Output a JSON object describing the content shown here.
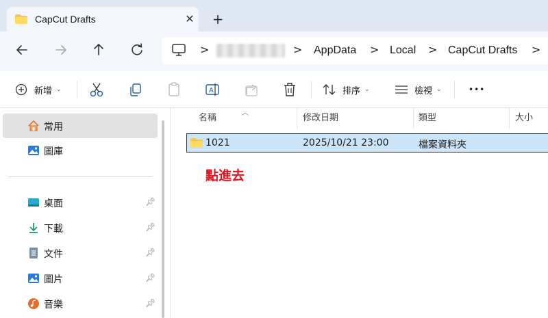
{
  "window": {
    "tab_title": "CapCut Drafts",
    "close_symbol": "✕",
    "new_tab_symbol": "+"
  },
  "nav": {
    "back_icon": "arrow-left-icon",
    "forward_icon": "arrow-right-icon",
    "up_icon": "arrow-up-icon",
    "refresh_icon": "refresh-icon"
  },
  "address": {
    "crumbs": [
      "AppData",
      "Local",
      "CapCut Drafts"
    ],
    "separator": ">"
  },
  "toolbar": {
    "new_label": "新增",
    "sort_label": "排序",
    "view_label": "檢視",
    "more_symbol": "•••"
  },
  "sidebar": {
    "items": [
      {
        "label": "常用",
        "icon": "home-icon"
      },
      {
        "label": "圖庫",
        "icon": "gallery-icon"
      },
      {
        "label": "桌面",
        "icon": "desktop-icon"
      },
      {
        "label": "下載",
        "icon": "download-icon"
      },
      {
        "label": "文件",
        "icon": "document-icon"
      },
      {
        "label": "圖片",
        "icon": "pictures-icon"
      },
      {
        "label": "音樂",
        "icon": "music-icon"
      }
    ],
    "pin_symbol": "📌"
  },
  "list": {
    "columns": [
      "名稱",
      "修改日期",
      "類型",
      "大小"
    ],
    "rows": [
      {
        "name": "1021",
        "modified": "2025/10/21 23:00",
        "type": "檔案資料夾",
        "size": ""
      }
    ]
  },
  "annotation": "點進去",
  "colors": {
    "selection": "#cce4f7",
    "annotation": "#e0141e",
    "folder": "#f6c74e"
  }
}
